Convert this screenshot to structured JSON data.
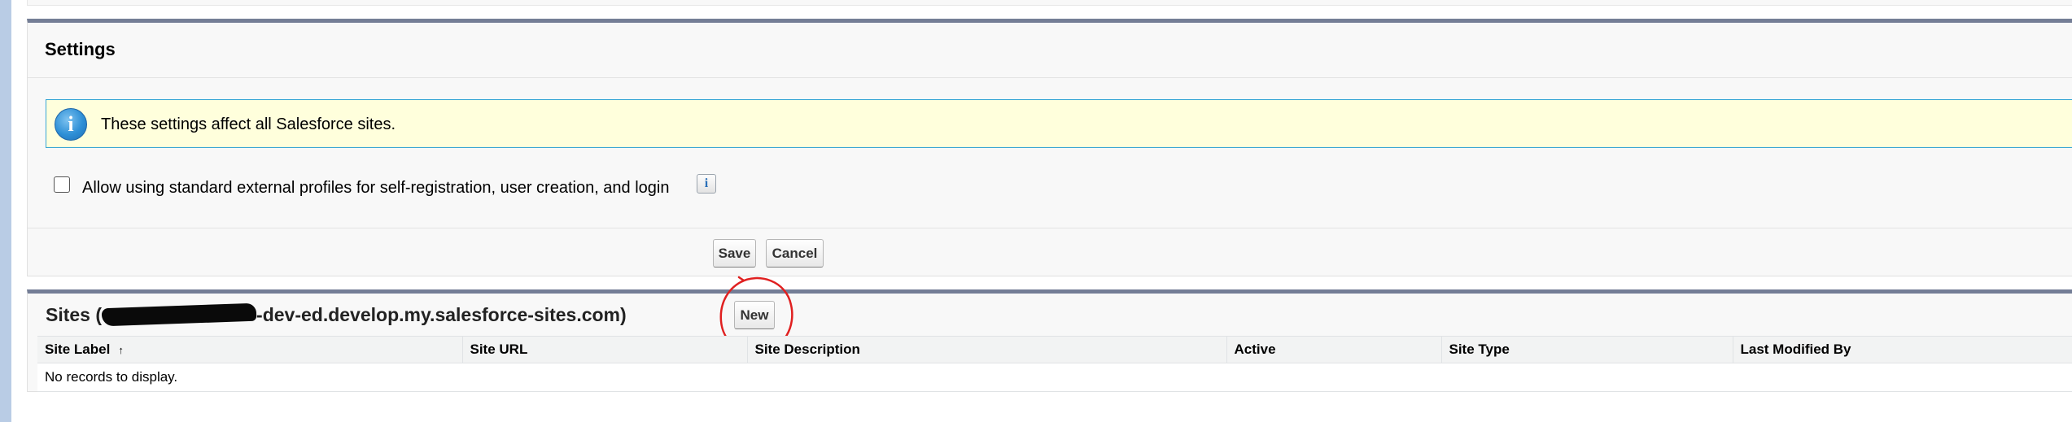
{
  "settings": {
    "title": "Settings",
    "info_icon": "i",
    "info_text": "These settings affect all Salesforce sites.",
    "checkbox_label": "Allow using standard external profiles for self-registration, user creation, and login",
    "checkbox_checked": false,
    "help_icon": "i",
    "save_label": "Save",
    "cancel_label": "Cancel"
  },
  "sites": {
    "title_prefix": "Sites (",
    "title_domain_visible": "-dev-ed.develop.my.salesforce-sites.com)",
    "new_label": "New",
    "columns": [
      "Site Label",
      "Site URL",
      "Site Description",
      "Active",
      "Site Type",
      "Last Modified By"
    ],
    "sort_indicator": "↑",
    "empty_message": "No records to display."
  },
  "colors": {
    "panel_border": "#747e96",
    "info_banner_bg": "#ffffdc",
    "info_banner_border": "#39a6d4",
    "annotation": "#e02020"
  }
}
